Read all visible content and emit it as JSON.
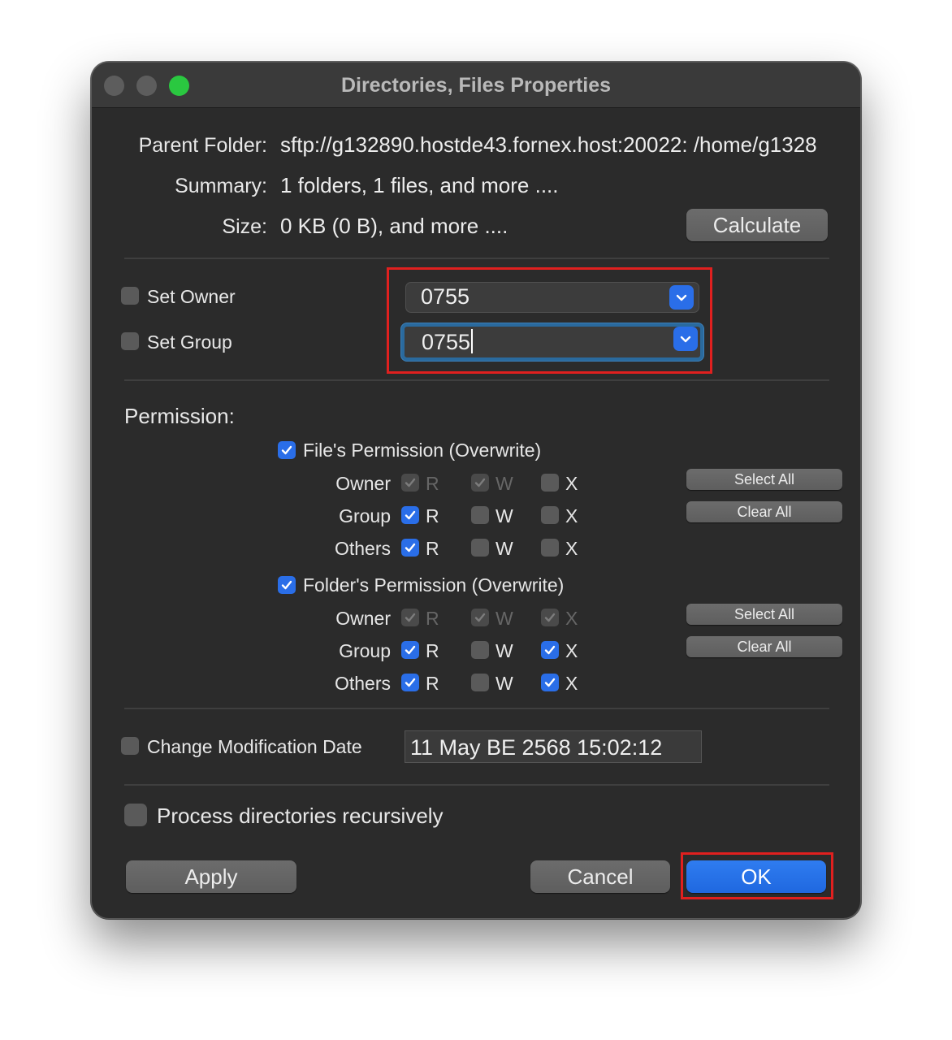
{
  "window": {
    "title": "Directories, Files Properties"
  },
  "info": {
    "parent_folder_label": "Parent Folder:",
    "parent_folder_value": "sftp://g132890.hostde43.fornex.host:20022: /home/g1328",
    "summary_label": "Summary:",
    "summary_value": "1 folders, 1 files, and more ....",
    "size_label": "Size:",
    "size_value": "0 KB (0 B), and more ....",
    "calculate_button": "Calculate"
  },
  "ownership": {
    "set_owner_label": "Set Owner",
    "set_group_label": "Set Group",
    "owner_value": "0755",
    "group_value": "0755"
  },
  "permission": {
    "title": "Permission:",
    "files_label": "File's Permission (Overwrite)",
    "folders_label": "Folder's Permission (Overwrite)",
    "rows": {
      "owner": "Owner",
      "group": "Group",
      "others": "Others"
    },
    "bits": {
      "r": "R",
      "w": "W",
      "x": "X"
    },
    "select_all": "Select All",
    "clear_all": "Clear All"
  },
  "modification": {
    "label": "Change Modification Date",
    "value": "11 May BE 2568 15:02:12"
  },
  "recursive_label": "Process directories recursively",
  "buttons": {
    "apply": "Apply",
    "cancel": "Cancel",
    "ok": "OK"
  }
}
